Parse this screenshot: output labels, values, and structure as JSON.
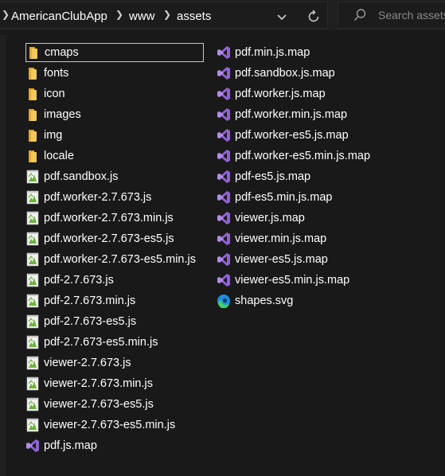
{
  "breadcrumb": {
    "parts": [
      "AmericanClubApp",
      "www",
      "assets"
    ]
  },
  "search": {
    "placeholder": "Search assets"
  },
  "column1": [
    {
      "name": "cmaps",
      "icon": "folder-icon",
      "selected": true
    },
    {
      "name": "fonts",
      "icon": "folder-icon"
    },
    {
      "name": "icon",
      "icon": "folder-icon"
    },
    {
      "name": "images",
      "icon": "folder-icon"
    },
    {
      "name": "img",
      "icon": "folder-icon"
    },
    {
      "name": "locale",
      "icon": "folder-icon"
    },
    {
      "name": "pdf.sandbox.js",
      "icon": "js-file-icon"
    },
    {
      "name": "pdf.worker-2.7.673.js",
      "icon": "js-file-icon"
    },
    {
      "name": "pdf.worker-2.7.673.min.js",
      "icon": "js-file-icon"
    },
    {
      "name": "pdf.worker-2.7.673-es5.js",
      "icon": "js-file-icon"
    },
    {
      "name": "pdf.worker-2.7.673-es5.min.js",
      "icon": "js-file-icon"
    },
    {
      "name": "pdf-2.7.673.js",
      "icon": "js-file-icon"
    },
    {
      "name": "pdf-2.7.673.min.js",
      "icon": "js-file-icon"
    },
    {
      "name": "pdf-2.7.673-es5.js",
      "icon": "js-file-icon"
    },
    {
      "name": "pdf-2.7.673-es5.min.js",
      "icon": "js-file-icon"
    },
    {
      "name": "viewer-2.7.673.js",
      "icon": "js-file-icon"
    },
    {
      "name": "viewer-2.7.673.min.js",
      "icon": "js-file-icon"
    },
    {
      "name": "viewer-2.7.673-es5.js",
      "icon": "js-file-icon"
    },
    {
      "name": "viewer-2.7.673-es5.min.js",
      "icon": "js-file-icon"
    },
    {
      "name": "pdf.js.map",
      "icon": "map-file-icon"
    }
  ],
  "column2": [
    {
      "name": "pdf.min.js.map",
      "icon": "map-file-icon"
    },
    {
      "name": "pdf.sandbox.js.map",
      "icon": "map-file-icon"
    },
    {
      "name": "pdf.worker.js.map",
      "icon": "map-file-icon"
    },
    {
      "name": "pdf.worker.min.js.map",
      "icon": "map-file-icon"
    },
    {
      "name": "pdf.worker-es5.js.map",
      "icon": "map-file-icon"
    },
    {
      "name": "pdf.worker-es5.min.js.map",
      "icon": "map-file-icon"
    },
    {
      "name": "pdf-es5.js.map",
      "icon": "map-file-icon"
    },
    {
      "name": "pdf-es5.min.js.map",
      "icon": "map-file-icon"
    },
    {
      "name": "viewer.js.map",
      "icon": "map-file-icon"
    },
    {
      "name": "viewer.min.js.map",
      "icon": "map-file-icon"
    },
    {
      "name": "viewer-es5.js.map",
      "icon": "map-file-icon"
    },
    {
      "name": "viewer-es5.min.js.map",
      "icon": "map-file-icon"
    },
    {
      "name": "shapes.svg",
      "icon": "edge-svg-icon"
    }
  ],
  "colors": {
    "background": "#191919",
    "folder": "#f4c95b",
    "vs_purple": "#8f62d6",
    "js_green": "#6fb33b",
    "edge_blue": "#1e8de0",
    "edge_green": "#3fcf6a"
  }
}
